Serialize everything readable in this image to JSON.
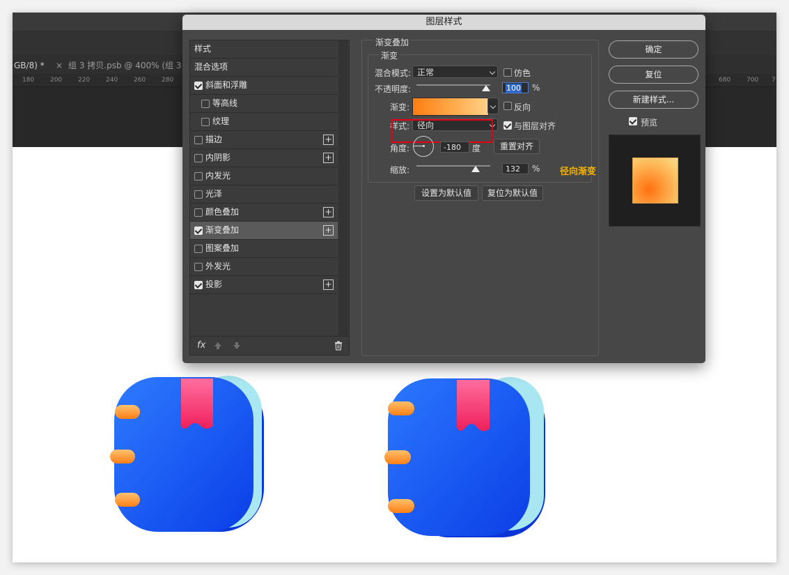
{
  "photoshop": {
    "tab_text": "GB/8) *",
    "tab2_close": "×",
    "tab2_text": "组 3 拷贝.psb @ 400% (组 3 拷",
    "ruler_left": [
      "180",
      "200",
      "220",
      "240",
      "260",
      "280"
    ],
    "ruler_right": [
      "680",
      "700",
      "7"
    ]
  },
  "dialog": {
    "title": "图层样式",
    "styles_header": "样式",
    "blend_options": "混合选项",
    "effects": [
      {
        "label": "斜面和浮雕",
        "checked": true,
        "plus": false,
        "indent": false
      },
      {
        "label": "等高线",
        "checked": false,
        "plus": false,
        "indent": true
      },
      {
        "label": "纹理",
        "checked": false,
        "plus": false,
        "indent": true
      },
      {
        "label": "描边",
        "checked": false,
        "plus": true,
        "indent": false
      },
      {
        "label": "内阴影",
        "checked": false,
        "plus": true,
        "indent": false
      },
      {
        "label": "内发光",
        "checked": false,
        "plus": false,
        "indent": false
      },
      {
        "label": "光泽",
        "checked": false,
        "plus": false,
        "indent": false
      },
      {
        "label": "颜色叠加",
        "checked": false,
        "plus": true,
        "indent": false
      },
      {
        "label": "渐变叠加",
        "checked": true,
        "plus": true,
        "indent": false,
        "selected": true
      },
      {
        "label": "图案叠加",
        "checked": false,
        "plus": false,
        "indent": false
      },
      {
        "label": "外发光",
        "checked": false,
        "plus": false,
        "indent": false
      },
      {
        "label": "投影",
        "checked": true,
        "plus": true,
        "indent": false
      }
    ],
    "footer_fx": "fx",
    "panel_title": "渐变叠加",
    "group_title": "渐变",
    "blend_mode_label": "混合模式:",
    "blend_mode_value": "正常",
    "dither_label": "仿色",
    "dither_checked": false,
    "opacity_label": "不透明度:",
    "opacity_value": "100",
    "opacity_unit": "%",
    "gradient_label": "渐变:",
    "reverse_label": "反向",
    "reverse_checked": false,
    "style_label": "样式:",
    "style_value": "径向",
    "align_label": "与图层对齐",
    "align_checked": true,
    "angle_label": "角度:",
    "angle_value": "-180",
    "angle_unit": "度",
    "reset_align": "重置对齐",
    "scale_label": "缩放:",
    "scale_value": "132",
    "scale_unit": "%",
    "set_default": "设置为默认值",
    "reset_default": "复位为默认值",
    "ok": "确定",
    "reset": "复位",
    "new_style": "新建样式...",
    "preview_label": "预览",
    "preview_checked": true,
    "opacity_fraction": 0.94,
    "scale_fraction": 0.8
  },
  "annotation": {
    "text": "径向渐变",
    "color": "#f5b400"
  },
  "colors": {
    "gradient_start": "#ff7d14",
    "gradient_end": "#ffd28a",
    "icon_blue": "#1a5cf0",
    "highlight_red": "#e60012"
  }
}
